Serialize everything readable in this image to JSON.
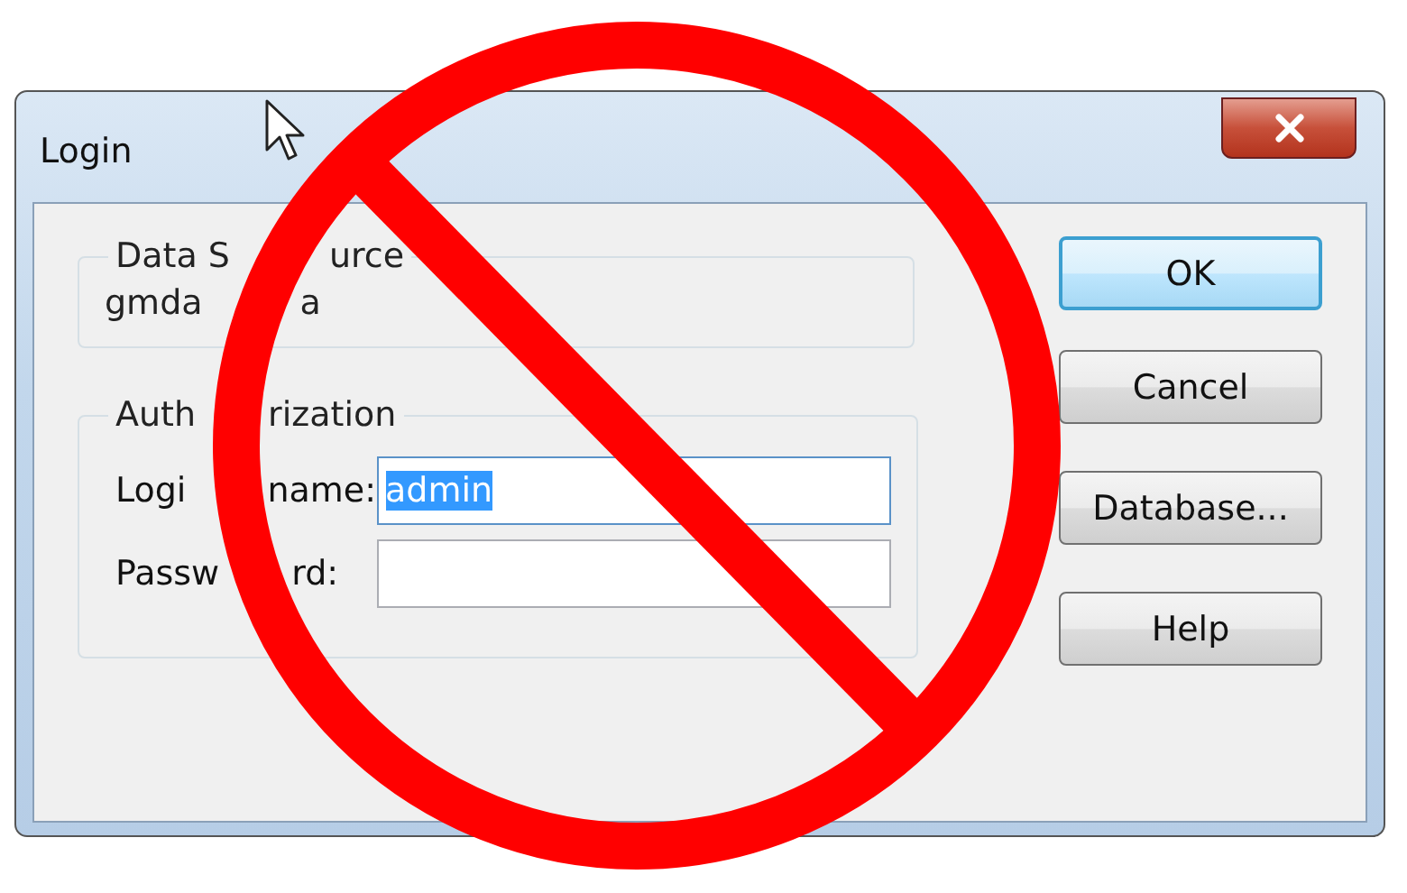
{
  "window": {
    "title": "Login"
  },
  "data_source": {
    "label_parts": [
      "Data S",
      "urce"
    ],
    "value_parts": [
      "gmda",
      "a"
    ]
  },
  "authorization": {
    "label_parts": [
      "Auth",
      "rization"
    ],
    "fields": [
      {
        "label_parts": [
          "Logi",
          "name:"
        ],
        "value": "admin",
        "text_selected": true
      },
      {
        "label_parts": [
          "Passw",
          "rd:"
        ]
      }
    ]
  },
  "buttons": [
    {
      "label": "OK",
      "default": true
    },
    {
      "label": "Cancel",
      "default": false
    },
    {
      "label": "Database...",
      "default": false
    },
    {
      "label": "Help",
      "default": false
    }
  ],
  "overlay": {
    "kind": "prohibition"
  }
}
